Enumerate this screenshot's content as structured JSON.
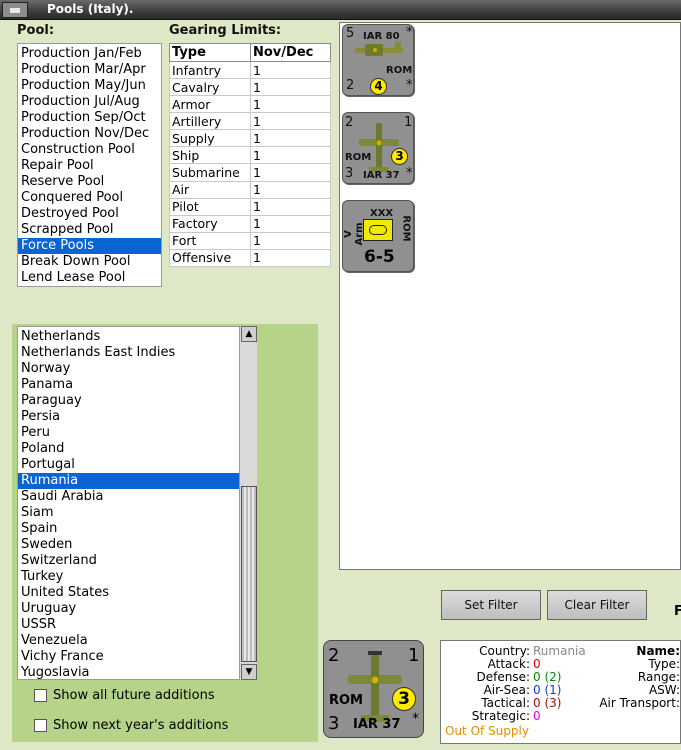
{
  "window": {
    "title": "Pools (Italy)."
  },
  "pool": {
    "label": "Pool:",
    "items": [
      "Production Jan/Feb",
      "Production Mar/Apr",
      "Production May/Jun",
      "Production Jul/Aug",
      "Production Sep/Oct",
      "Production Nov/Dec",
      "Construction Pool",
      "Repair Pool",
      "Reserve Pool",
      "Conquered Pool",
      "Destroyed Pool",
      "Scrapped Pool",
      "Force Pools",
      "Break Down Pool",
      "Lend Lease Pool"
    ],
    "selected": "Force Pools"
  },
  "gearing": {
    "label": "Gearing Limits:",
    "headers": [
      "Type",
      "Nov/Dec"
    ],
    "rows": [
      [
        "Infantry",
        "1"
      ],
      [
        "Cavalry",
        "1"
      ],
      [
        "Armor",
        "1"
      ],
      [
        "Artillery",
        "1"
      ],
      [
        "Supply",
        "1"
      ],
      [
        "Ship",
        "1"
      ],
      [
        "Submarine",
        "1"
      ],
      [
        "Air",
        "1"
      ],
      [
        "Pilot",
        "1"
      ],
      [
        "Factory",
        "1"
      ],
      [
        "Fort",
        "1"
      ],
      [
        "Offensive",
        "1"
      ]
    ]
  },
  "countries": {
    "items": [
      "Netherlands",
      "Netherlands East Indies",
      "Norway",
      "Panama",
      "Paraguay",
      "Persia",
      "Peru",
      "Poland",
      "Portugal",
      "Rumania",
      "Saudi Arabia",
      "Siam",
      "Spain",
      "Sweden",
      "Switzerland",
      "Turkey",
      "United States",
      "Uruguay",
      "USSR",
      "Venezuela",
      "Vichy France",
      "Yugoslavia"
    ],
    "selected": "Rumania"
  },
  "options": {
    "show_future": "Show all future additions",
    "show_next_year": "Show next year's additions"
  },
  "counters": {
    "iar80": {
      "tl": "5",
      "name": "IAR 80",
      "star": "*",
      "nation": "ROM",
      "bl": "2",
      "circle": "4",
      "star2": "*"
    },
    "iar37": {
      "tl": "2",
      "tr": "1",
      "nation": "ROM",
      "circle": "3",
      "bl": "3",
      "name": "IAR 37",
      "star": "*"
    },
    "armor": {
      "size": "XXX",
      "left": "V Arm",
      "right": "ROM",
      "strength": "6-5"
    }
  },
  "buttons": {
    "set_filter": "Set Filter",
    "clear_filter": "Clear Filter",
    "partial": "F"
  },
  "big_counter": {
    "tl": "2",
    "tr": "1",
    "nation": "ROM",
    "circle": "3",
    "bl": "3",
    "name": "IAR 37",
    "star": "*"
  },
  "info": {
    "country_label": "Country:",
    "country_value": "Rumania",
    "attack_label": "Attack:",
    "attack_value": "0",
    "defense_label": "Defense:",
    "defense_value": "0",
    "defense_paren": "(2)",
    "airsea_label": "Air-Sea:",
    "airsea_value": "0",
    "airsea_paren": "(1)",
    "tactical_label": "Tactical:",
    "tactical_value": "0",
    "tactical_paren": "(3)",
    "strategic_label": "Strategic:",
    "strategic_value": "0",
    "supply_status": "Out Of Supply",
    "name_label": "Name:",
    "type_label": "Type:",
    "range_label": "Range:",
    "asw_label": "ASW:",
    "air_transport_label": "Air Transport:"
  }
}
